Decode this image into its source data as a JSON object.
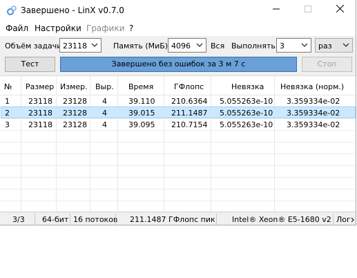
{
  "window": {
    "title": "Завершено - LinX v0.7.0"
  },
  "menu": {
    "items": [
      "Файл",
      "Настройки",
      "Графики",
      "?"
    ]
  },
  "controls": {
    "problem_size_label": "Объём задачи:",
    "problem_size_value": "23118",
    "memory_label": "Память (МиБ):",
    "memory_value": "4096",
    "all_label": "Вся",
    "run_label": "Выполнять:",
    "run_value": "3",
    "run_unit": "раз",
    "test_button": "Тест",
    "stop_button": "Стоп",
    "status_message": "Завершено без ошибок за 3 м 7 с"
  },
  "table": {
    "headers": [
      "№",
      "Размер",
      "Измер.",
      "Выр.",
      "Время",
      "ГФлопс",
      "Невязка",
      "Невязка (норм.)"
    ],
    "rows": [
      [
        "1",
        "23118",
        "23128",
        "4",
        "39.110",
        "210.6364",
        "5.055263e-10",
        "3.359334e-02"
      ],
      [
        "2",
        "23118",
        "23128",
        "4",
        "39.015",
        "211.1487",
        "5.055263e-10",
        "3.359334e-02"
      ],
      [
        "3",
        "23118",
        "23128",
        "4",
        "39.095",
        "210.7154",
        "5.055263e-10",
        "3.359334e-02"
      ]
    ],
    "selected_row": 2
  },
  "status": {
    "progress": "3/3",
    "bits": "64-бит",
    "threads": "16 потоков",
    "peak": "211.1487 ГФлопс пик",
    "cpu": "Intel® Xeon® E5-1680 v2",
    "log": "Лог"
  },
  "colors": {
    "progress_fill": "#6aa0d8",
    "selection": "#cce8ff"
  }
}
